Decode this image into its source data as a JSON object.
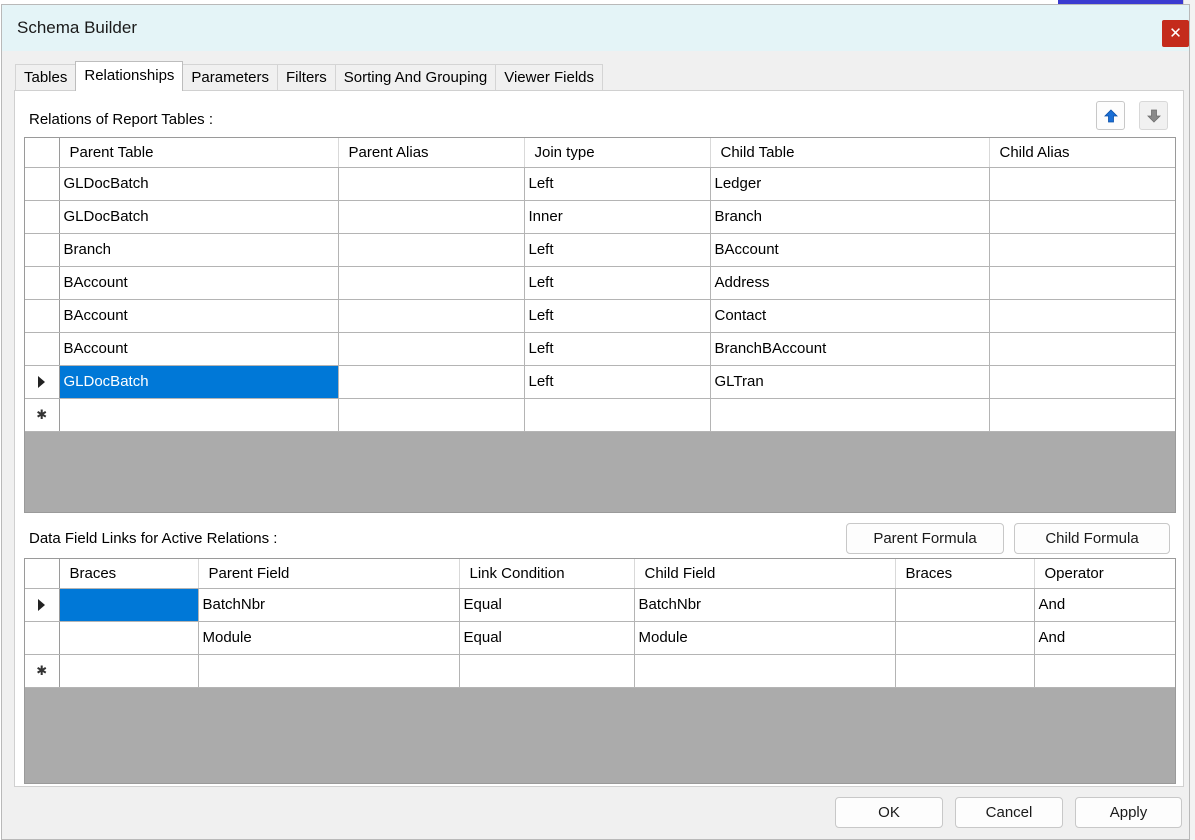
{
  "window": {
    "title": "Schema Builder",
    "close_symbol": "✕"
  },
  "tabs": [
    {
      "label": "Tables",
      "active": false
    },
    {
      "label": "Relationships",
      "active": true
    },
    {
      "label": "Parameters",
      "active": false
    },
    {
      "label": "Filters",
      "active": false
    },
    {
      "label": "Sorting And Grouping",
      "active": false
    },
    {
      "label": "Viewer Fields",
      "active": false
    }
  ],
  "relations": {
    "label": "Relations of Report Tables :",
    "columns": [
      "Parent Table",
      "Parent Alias",
      "Join type",
      "Child Table",
      "Child Alias"
    ],
    "rows": [
      [
        "GLDocBatch",
        "",
        "Left",
        "Ledger",
        ""
      ],
      [
        "GLDocBatch",
        "",
        "Inner",
        "Branch",
        ""
      ],
      [
        "Branch",
        "",
        "Left",
        "BAccount",
        ""
      ],
      [
        "BAccount",
        "",
        "Left",
        "Address",
        ""
      ],
      [
        "BAccount",
        "",
        "Left",
        "Contact",
        ""
      ],
      [
        "BAccount",
        "",
        "Left",
        "BranchBAccount",
        ""
      ],
      [
        "GLDocBatch",
        "",
        "Left",
        "GLTran",
        ""
      ]
    ],
    "current_row": 6,
    "selected_cell": [
      6,
      0
    ],
    "new_row_marker": "✱",
    "move_up_icon": "arrow-up-icon",
    "move_down_icon": "arrow-down-icon"
  },
  "links": {
    "label": "Data Field Links for Active Relations :",
    "parent_formula_label": "Parent Formula",
    "child_formula_label": "Child Formula",
    "columns": [
      "Braces",
      "Parent Field",
      "Link Condition",
      "Child Field",
      "Braces",
      "Operator"
    ],
    "rows": [
      [
        "",
        "BatchNbr",
        "Equal",
        "BatchNbr",
        "",
        "And"
      ],
      [
        "",
        "Module",
        "Equal",
        "Module",
        "",
        "And"
      ]
    ],
    "current_row": 0,
    "selected_cell": [
      0,
      0
    ],
    "new_row_marker": "✱"
  },
  "footer": {
    "ok_label": "OK",
    "cancel_label": "Cancel",
    "apply_label": "Apply"
  },
  "colors": {
    "selection": "#0078d7",
    "titlebar": "#e4f4f7",
    "close": "#c42b1c",
    "arrow_blue": "#1a6fd6",
    "arrow_gray": "#8a8a8a"
  }
}
